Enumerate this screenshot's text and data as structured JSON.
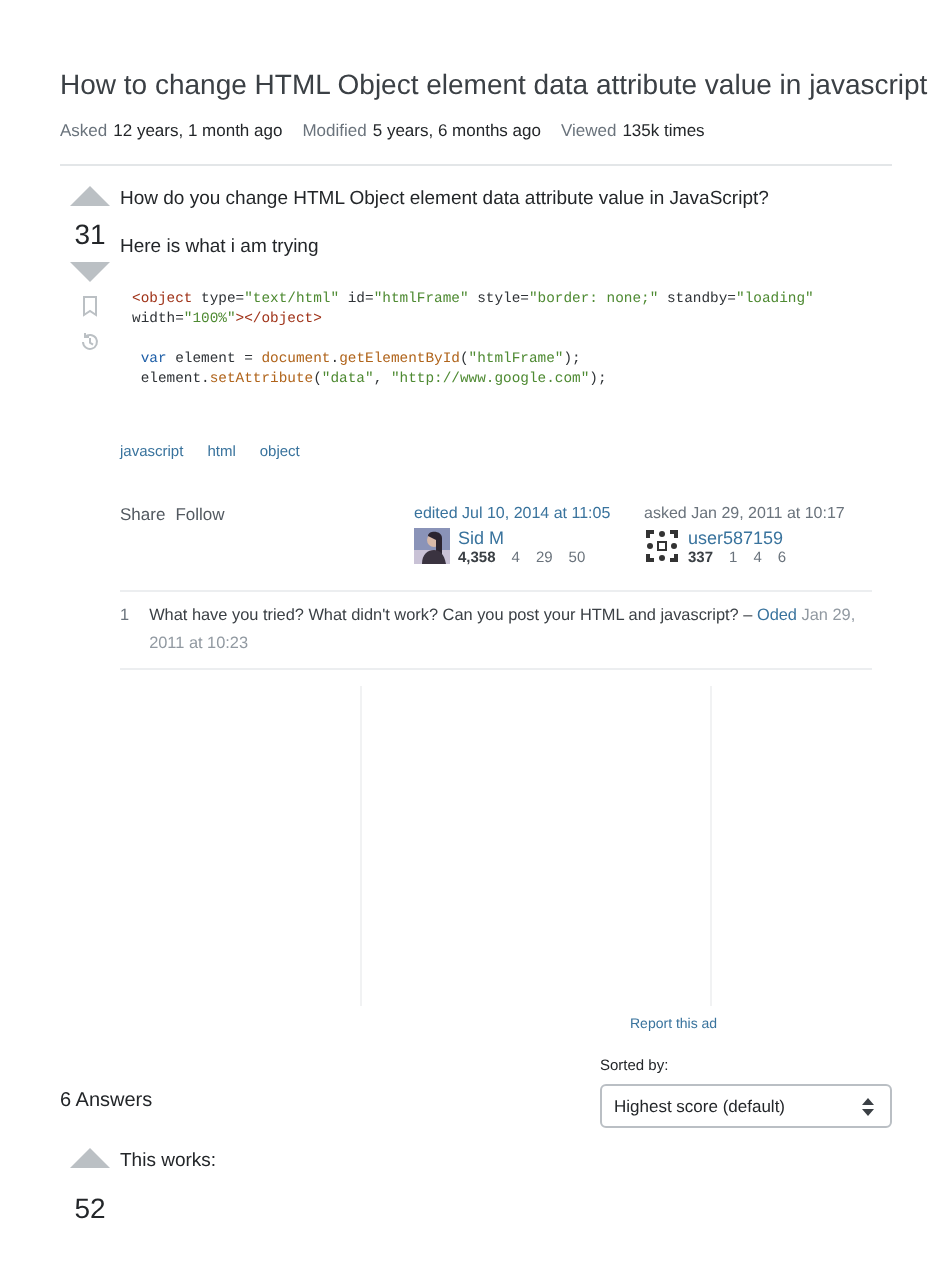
{
  "question": {
    "title": "How to change HTML Object element data attribute value in javascript",
    "meta": [
      {
        "label": "Asked",
        "value": "12 years, 1 month ago"
      },
      {
        "label": "Modified",
        "value": "5 years, 6 months ago"
      },
      {
        "label": "Viewed",
        "value": "135k times"
      }
    ],
    "score": "31",
    "body": [
      "How do you change HTML Object element data attribute value in JavaScript?",
      "Here is what i am trying"
    ],
    "code": [
      [
        [
          {
            "kind": "tag",
            "text": "<object"
          },
          {
            "kind": "plain",
            "text": " type="
          },
          {
            "kind": "str",
            "text": "\"text/html\""
          },
          {
            "kind": "plain",
            "text": " id="
          },
          {
            "kind": "str",
            "text": "\"htmlFrame\""
          },
          {
            "kind": "plain",
            "text": " style="
          },
          {
            "kind": "str",
            "text": "\"border: none;\""
          },
          {
            "kind": "plain",
            "text": " standby="
          },
          {
            "kind": "str",
            "text": "\"loading\""
          }
        ],
        [
          {
            "kind": "plain",
            "text": "width="
          },
          {
            "kind": "str",
            "text": "\"100%\""
          },
          {
            "kind": "tag",
            "text": "></object>"
          }
        ]
      ],
      [
        [
          {
            "kind": "keyword",
            "text": " var"
          },
          {
            "kind": "plain",
            "text": " element = "
          },
          {
            "kind": "method",
            "text": "document"
          },
          {
            "kind": "plain",
            "text": "."
          },
          {
            "kind": "method",
            "text": "getElementById"
          },
          {
            "kind": "plain",
            "text": "("
          },
          {
            "kind": "str",
            "text": "\"htmlFrame\""
          },
          {
            "kind": "plain",
            "text": ");"
          }
        ],
        [
          {
            "kind": "plain",
            "text": " element."
          },
          {
            "kind": "method",
            "text": "setAttribute"
          },
          {
            "kind": "plain",
            "text": "("
          },
          {
            "kind": "str",
            "text": "\"data\""
          },
          {
            "kind": "plain",
            "text": ", "
          },
          {
            "kind": "str",
            "text": "\"http://www.google.com\""
          },
          {
            "kind": "plain",
            "text": ");"
          }
        ]
      ]
    ],
    "tags": [
      "javascript",
      "html",
      "object"
    ],
    "actions": [
      "Share",
      "Follow"
    ],
    "cards": [
      {
        "caption": "edited Jul 10, 2014 at 11:05",
        "user": "Sid M",
        "reputation": "4,358",
        "badges": [
          "4",
          "29",
          "50"
        ]
      },
      {
        "kind": "identicon",
        "caption": "asked Jan 29, 2011 at 10:17",
        "user": "user587159",
        "reputation": "337",
        "badges": [
          "1",
          "4",
          "6"
        ]
      }
    ],
    "comments": [
      {
        "score": "1",
        "text": "What have you tried? What didn't work? Can you post your HTML and javascript? – ",
        "author": "Oded",
        "date": "Jan 29, 2011 at 10:23"
      }
    ]
  },
  "report_ad": "Report this ad",
  "answers": {
    "count": "6 Answers",
    "sort_label": "Sorted by:",
    "sort_value": "Highest score (default)",
    "items": [
      {
        "score": "52",
        "text": "This works:"
      }
    ]
  }
}
